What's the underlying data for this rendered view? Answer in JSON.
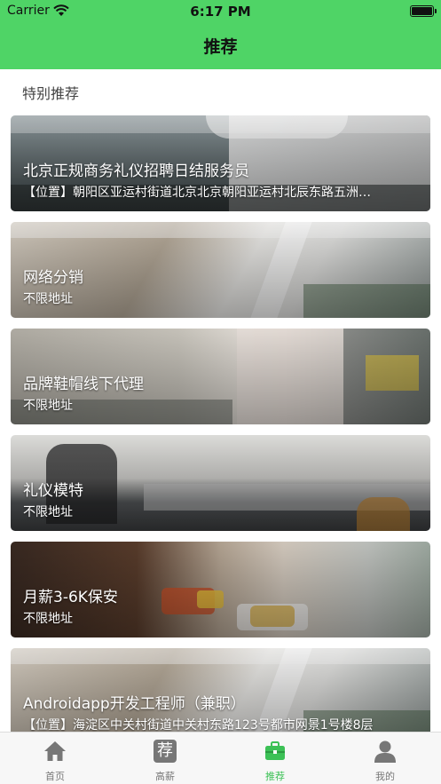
{
  "status_bar": {
    "carrier": "Carrier",
    "time": "6:17 PM"
  },
  "nav": {
    "title": "推荐"
  },
  "section": {
    "title": "特别推荐"
  },
  "cards": [
    {
      "title": "北京正规商务礼仪招聘日结服务员",
      "subtitle": "【位置】朝阳区亚运村街道北京北京朝阳亚运村北辰东路五洲…"
    },
    {
      "title": "网络分销",
      "subtitle": "不限地址"
    },
    {
      "title": "品牌鞋帽线下代理",
      "subtitle": "不限地址"
    },
    {
      "title": "礼仪模特",
      "subtitle": "不限地址"
    },
    {
      "title": "月薪3-6K保安",
      "subtitle": "不限地址"
    },
    {
      "title": "Androidapp开发工程师（兼职）",
      "subtitle": "【位置】海淀区中关村街道中关村东路123号都市网景1号楼8层"
    }
  ],
  "tabs": [
    {
      "label": "首页",
      "icon": "home-icon"
    },
    {
      "label": "高薪",
      "icon": "recommend-icon",
      "glyph": "荐"
    },
    {
      "label": "推荐",
      "icon": "briefcase-icon"
    },
    {
      "label": "我的",
      "icon": "person-icon"
    }
  ],
  "colors": {
    "brand_green": "#4fd466",
    "active_tab": "#3cc156",
    "inactive_tab": "#777777"
  }
}
